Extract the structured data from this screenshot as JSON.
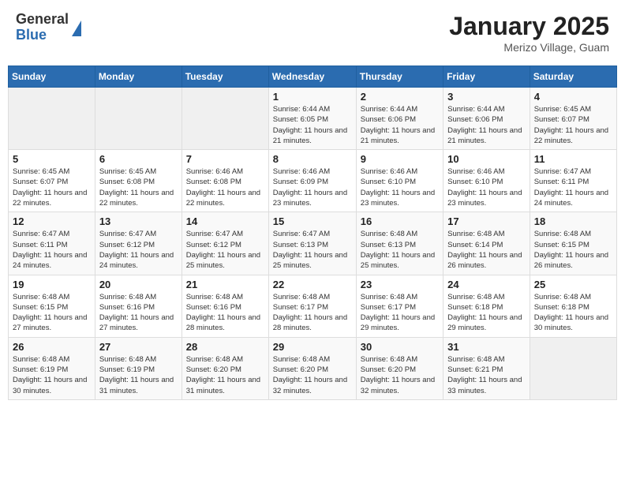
{
  "header": {
    "logo_general": "General",
    "logo_blue": "Blue",
    "title": "January 2025",
    "location": "Merizo Village, Guam"
  },
  "days_of_week": [
    "Sunday",
    "Monday",
    "Tuesday",
    "Wednesday",
    "Thursday",
    "Friday",
    "Saturday"
  ],
  "weeks": [
    [
      {
        "day": "",
        "info": ""
      },
      {
        "day": "",
        "info": ""
      },
      {
        "day": "",
        "info": ""
      },
      {
        "day": "1",
        "info": "Sunrise: 6:44 AM\nSunset: 6:05 PM\nDaylight: 11 hours and 21 minutes."
      },
      {
        "day": "2",
        "info": "Sunrise: 6:44 AM\nSunset: 6:06 PM\nDaylight: 11 hours and 21 minutes."
      },
      {
        "day": "3",
        "info": "Sunrise: 6:44 AM\nSunset: 6:06 PM\nDaylight: 11 hours and 21 minutes."
      },
      {
        "day": "4",
        "info": "Sunrise: 6:45 AM\nSunset: 6:07 PM\nDaylight: 11 hours and 22 minutes."
      }
    ],
    [
      {
        "day": "5",
        "info": "Sunrise: 6:45 AM\nSunset: 6:07 PM\nDaylight: 11 hours and 22 minutes."
      },
      {
        "day": "6",
        "info": "Sunrise: 6:45 AM\nSunset: 6:08 PM\nDaylight: 11 hours and 22 minutes."
      },
      {
        "day": "7",
        "info": "Sunrise: 6:46 AM\nSunset: 6:08 PM\nDaylight: 11 hours and 22 minutes."
      },
      {
        "day": "8",
        "info": "Sunrise: 6:46 AM\nSunset: 6:09 PM\nDaylight: 11 hours and 23 minutes."
      },
      {
        "day": "9",
        "info": "Sunrise: 6:46 AM\nSunset: 6:10 PM\nDaylight: 11 hours and 23 minutes."
      },
      {
        "day": "10",
        "info": "Sunrise: 6:46 AM\nSunset: 6:10 PM\nDaylight: 11 hours and 23 minutes."
      },
      {
        "day": "11",
        "info": "Sunrise: 6:47 AM\nSunset: 6:11 PM\nDaylight: 11 hours and 24 minutes."
      }
    ],
    [
      {
        "day": "12",
        "info": "Sunrise: 6:47 AM\nSunset: 6:11 PM\nDaylight: 11 hours and 24 minutes."
      },
      {
        "day": "13",
        "info": "Sunrise: 6:47 AM\nSunset: 6:12 PM\nDaylight: 11 hours and 24 minutes."
      },
      {
        "day": "14",
        "info": "Sunrise: 6:47 AM\nSunset: 6:12 PM\nDaylight: 11 hours and 25 minutes."
      },
      {
        "day": "15",
        "info": "Sunrise: 6:47 AM\nSunset: 6:13 PM\nDaylight: 11 hours and 25 minutes."
      },
      {
        "day": "16",
        "info": "Sunrise: 6:48 AM\nSunset: 6:13 PM\nDaylight: 11 hours and 25 minutes."
      },
      {
        "day": "17",
        "info": "Sunrise: 6:48 AM\nSunset: 6:14 PM\nDaylight: 11 hours and 26 minutes."
      },
      {
        "day": "18",
        "info": "Sunrise: 6:48 AM\nSunset: 6:15 PM\nDaylight: 11 hours and 26 minutes."
      }
    ],
    [
      {
        "day": "19",
        "info": "Sunrise: 6:48 AM\nSunset: 6:15 PM\nDaylight: 11 hours and 27 minutes."
      },
      {
        "day": "20",
        "info": "Sunrise: 6:48 AM\nSunset: 6:16 PM\nDaylight: 11 hours and 27 minutes."
      },
      {
        "day": "21",
        "info": "Sunrise: 6:48 AM\nSunset: 6:16 PM\nDaylight: 11 hours and 28 minutes."
      },
      {
        "day": "22",
        "info": "Sunrise: 6:48 AM\nSunset: 6:17 PM\nDaylight: 11 hours and 28 minutes."
      },
      {
        "day": "23",
        "info": "Sunrise: 6:48 AM\nSunset: 6:17 PM\nDaylight: 11 hours and 29 minutes."
      },
      {
        "day": "24",
        "info": "Sunrise: 6:48 AM\nSunset: 6:18 PM\nDaylight: 11 hours and 29 minutes."
      },
      {
        "day": "25",
        "info": "Sunrise: 6:48 AM\nSunset: 6:18 PM\nDaylight: 11 hours and 30 minutes."
      }
    ],
    [
      {
        "day": "26",
        "info": "Sunrise: 6:48 AM\nSunset: 6:19 PM\nDaylight: 11 hours and 30 minutes."
      },
      {
        "day": "27",
        "info": "Sunrise: 6:48 AM\nSunset: 6:19 PM\nDaylight: 11 hours and 31 minutes."
      },
      {
        "day": "28",
        "info": "Sunrise: 6:48 AM\nSunset: 6:20 PM\nDaylight: 11 hours and 31 minutes."
      },
      {
        "day": "29",
        "info": "Sunrise: 6:48 AM\nSunset: 6:20 PM\nDaylight: 11 hours and 32 minutes."
      },
      {
        "day": "30",
        "info": "Sunrise: 6:48 AM\nSunset: 6:20 PM\nDaylight: 11 hours and 32 minutes."
      },
      {
        "day": "31",
        "info": "Sunrise: 6:48 AM\nSunset: 6:21 PM\nDaylight: 11 hours and 33 minutes."
      },
      {
        "day": "",
        "info": ""
      }
    ]
  ]
}
